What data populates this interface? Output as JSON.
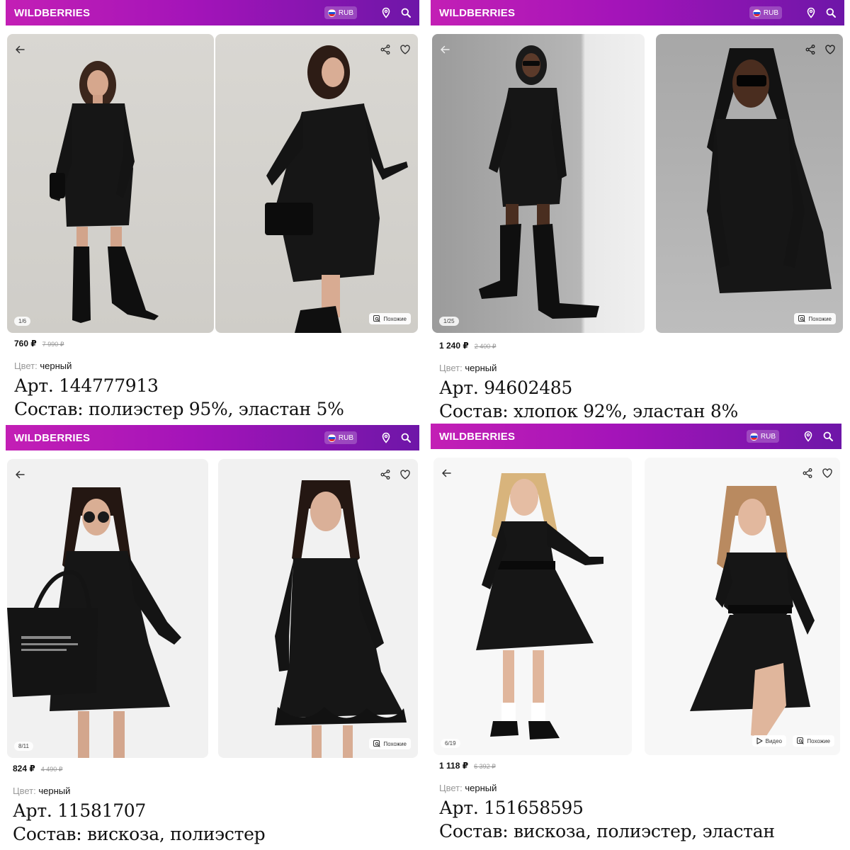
{
  "panels": [
    {
      "brand": "WILDBERRIES",
      "currency": "RUB",
      "photo_counter": "1/6",
      "chips": [
        "Похожие"
      ],
      "price": "760 ₽",
      "old_price": "7 990 ₽",
      "color_label": "Цвет:",
      "color_value": "черный",
      "article": "Арт. 144777913",
      "composition": "Состав: полиэстер 95%, эластан 5%"
    },
    {
      "brand": "WILDBERRIES",
      "currency": "RUB",
      "photo_counter": "1/25",
      "chips": [
        "Похожие"
      ],
      "price": "1 240 ₽",
      "old_price": "2 400 ₽",
      "color_label": "Цвет:",
      "color_value": "черный",
      "article": "Арт. 94602485",
      "composition": "Состав: хлопок 92%, эластан 8%"
    },
    {
      "brand": "WILDBERRIES",
      "currency": "RUB",
      "photo_counter": "8/11",
      "chips": [
        "Похожие"
      ],
      "price": "824 ₽",
      "old_price": "4 490 ₽",
      "color_label": "Цвет:",
      "color_value": "черный",
      "article": "Арт. 11581707",
      "composition": "Состав: вискоза, полиэстер"
    },
    {
      "brand": "WILDBERRIES",
      "currency": "RUB",
      "photo_counter": "6/19",
      "chips": [
        "Видео",
        "Похожие"
      ],
      "price": "1 118 ₽",
      "old_price": "6 392 ₽",
      "color_label": "Цвет:",
      "color_value": "черный",
      "article": "Арт. 151658595",
      "composition": "Состав: вискоза, полиэстер, эластан"
    }
  ],
  "colors": {
    "header_gradient_start": "#c31fb5",
    "header_gradient_end": "#6e16a8",
    "dress": "#161616"
  },
  "icons": [
    "back-arrow-icon",
    "share-icon",
    "heart-icon",
    "location-pin-icon",
    "search-icon",
    "similar-search-icon",
    "play-icon"
  ]
}
